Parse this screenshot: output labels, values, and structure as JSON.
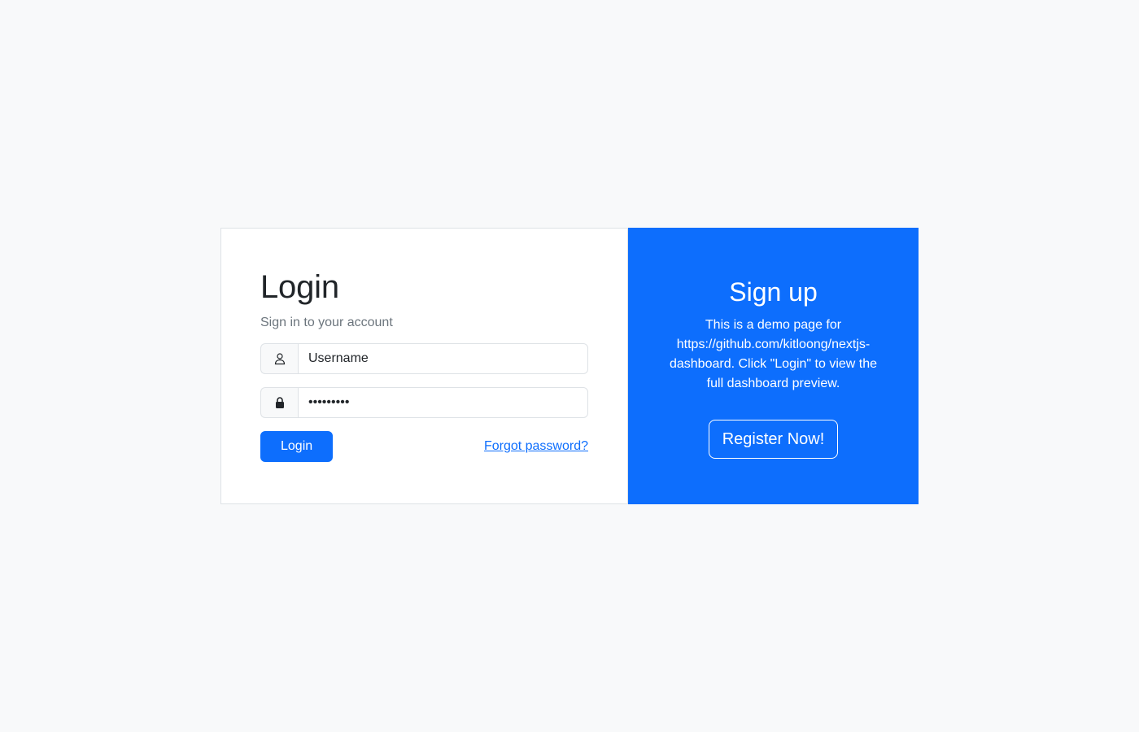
{
  "colors": {
    "background": "#f8f9fa",
    "primary": "#0d6efd",
    "text": "#212529",
    "muted": "#6c757d",
    "border": "#dee2e6"
  },
  "login": {
    "title": "Login",
    "subtitle": "Sign in to your account",
    "username": {
      "icon": "user-icon",
      "placeholder": "Username",
      "value": ""
    },
    "password": {
      "icon": "lock-icon",
      "value": "password1"
    },
    "login_button": "Login",
    "forgot_link": "Forgot password?"
  },
  "signup": {
    "title": "Sign up",
    "text": "This is a demo page for https://github.com/kitloong/nextjs-dashboard. Click \"Login\" to view the full dashboard preview.",
    "register_button": "Register Now!"
  }
}
